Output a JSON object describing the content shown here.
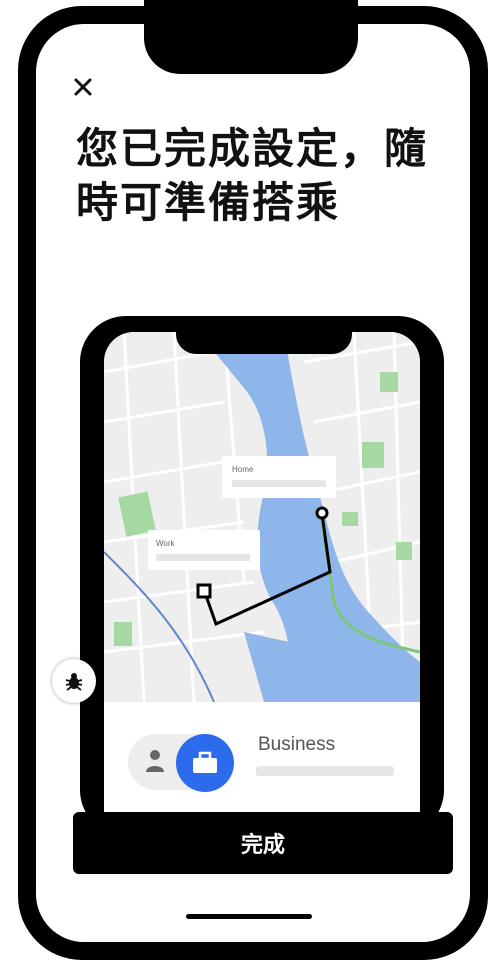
{
  "dialog": {
    "close_icon": "close-icon",
    "title_line1": "您已完成設定，隨",
    "title_line2": "時可準備搭乘"
  },
  "illustration": {
    "map": {
      "home_label": "Home",
      "work_label": "Work",
      "water_color": "#8fb6ea",
      "park_color": "#a6d8a4",
      "route_color": "#000000"
    },
    "profile": {
      "person_icon": "person-icon",
      "briefcase_icon": "briefcase-icon",
      "accent_color": "#2c6bec",
      "label": "Business"
    }
  },
  "debug_button": {
    "icon": "bug-icon"
  },
  "primary_button": {
    "label": "完成"
  }
}
